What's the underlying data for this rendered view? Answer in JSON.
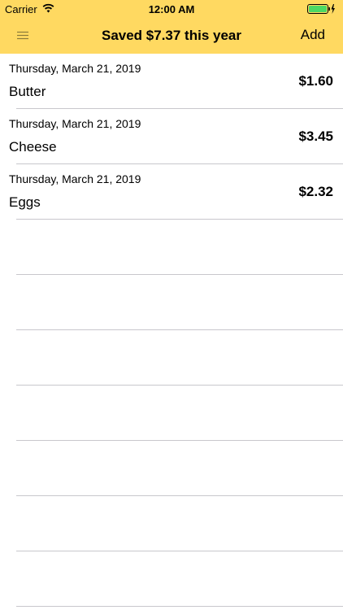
{
  "status_bar": {
    "carrier": "Carrier",
    "time": "12:00 AM"
  },
  "nav": {
    "title": "Saved $7.37 this year",
    "add_label": "Add",
    "menu_icon": "hamburger-menu-icon",
    "accent_color": "#ffd961"
  },
  "items": [
    {
      "date": "Thursday, March 21, 2019",
      "name": "Butter",
      "price": "$1.60"
    },
    {
      "date": "Thursday, March 21, 2019",
      "name": "Cheese",
      "price": "$3.45"
    },
    {
      "date": "Thursday, March 21, 2019",
      "name": "Eggs",
      "price": "$2.32"
    }
  ]
}
